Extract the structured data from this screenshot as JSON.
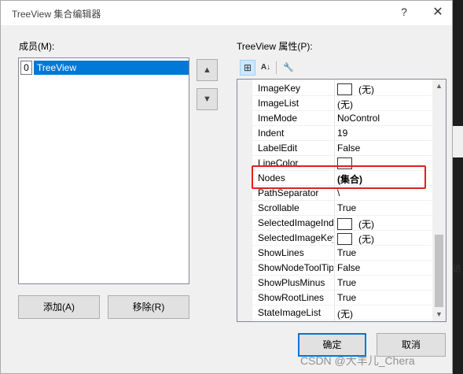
{
  "window": {
    "title": "TreeView 集合编辑器",
    "help_glyph": "?",
    "close_glyph": "✕"
  },
  "members": {
    "label": "成员(M):",
    "items": [
      {
        "index": "0",
        "name": "TreeView"
      }
    ],
    "move_up_glyph": "▲",
    "move_down_glyph": "▼",
    "add_label": "添加(A)",
    "remove_label": "移除(R)"
  },
  "properties": {
    "label": "TreeView 属性(P):",
    "toolbar": {
      "categorized_icon": "⊞",
      "alphabetical_icon": "A↓",
      "property_pages_icon": "🔧"
    },
    "rows": [
      {
        "name": "ImageKey",
        "value": "(无)",
        "swatch": true
      },
      {
        "name": "ImageList",
        "value": "(无)",
        "swatch": false
      },
      {
        "name": "ImeMode",
        "value": "NoControl",
        "swatch": false
      },
      {
        "name": "Indent",
        "value": "19",
        "swatch": false
      },
      {
        "name": "LabelEdit",
        "value": "False",
        "swatch": false
      },
      {
        "name": "LineColor",
        "value": "",
        "swatch": true
      },
      {
        "name": "Nodes",
        "value": "(集合)",
        "swatch": false,
        "bold": true
      },
      {
        "name": "PathSeparator",
        "value": "\\",
        "swatch": false
      },
      {
        "name": "Scrollable",
        "value": "True",
        "swatch": false
      },
      {
        "name": "SelectedImageIndex",
        "value": "(无)",
        "swatch": true
      },
      {
        "name": "SelectedImageKey",
        "value": "(无)",
        "swatch": true
      },
      {
        "name": "ShowLines",
        "value": "True",
        "swatch": false
      },
      {
        "name": "ShowNodeToolTips",
        "value": "False",
        "swatch": false
      },
      {
        "name": "ShowPlusMinus",
        "value": "True",
        "swatch": false
      },
      {
        "name": "ShowRootLines",
        "value": "True",
        "swatch": false
      },
      {
        "name": "StateImageList",
        "value": "(无)",
        "swatch": false
      }
    ]
  },
  "footer": {
    "ok_label": "确定",
    "cancel_label": "取消"
  },
  "watermark": "CSDN @大羊儿_Chera",
  "background_glyph": "访",
  "colors": {
    "selection": "#0078d7",
    "highlight_box": "#e02020",
    "dialog_bg": "#f0f0f0"
  }
}
